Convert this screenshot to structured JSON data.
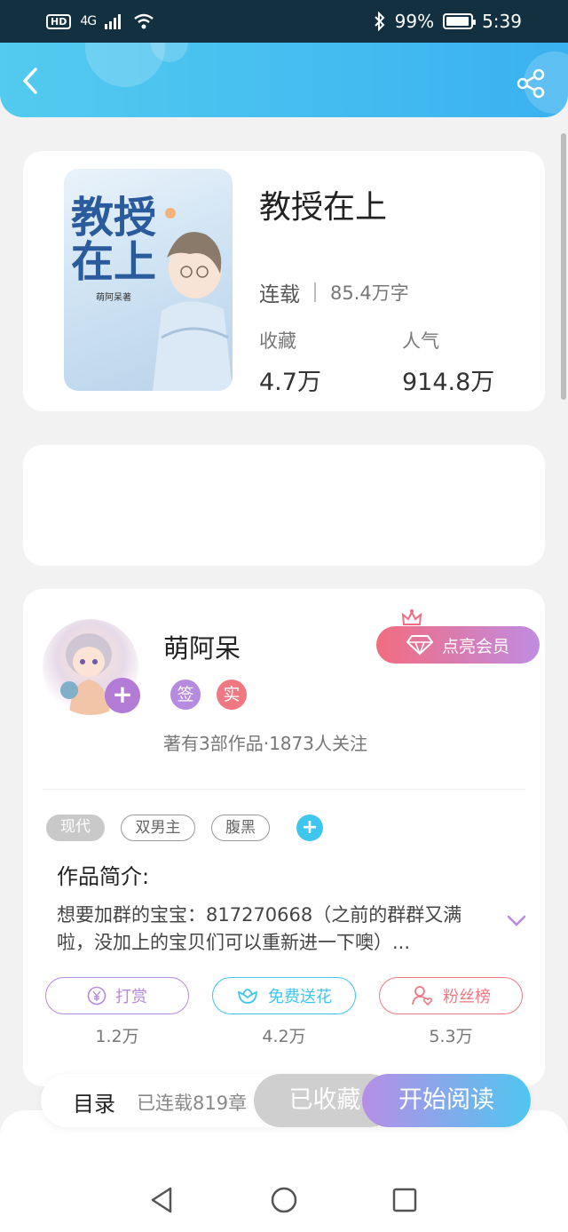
{
  "status_bar": {
    "hd_badge": "HD",
    "signal": "4G",
    "battery_percent": "99%",
    "time": "5:39"
  },
  "header": {
    "back_icon": "chevron-left-icon",
    "share_icon": "share-icon"
  },
  "book": {
    "cover_title": "教授在上",
    "cover_author": "萌阿呆著",
    "title": "教授在上",
    "status": "连载",
    "word_count": "85.4万字",
    "favorites_label": "收藏",
    "favorites_value": "4.7万",
    "popularity_label": "人气",
    "popularity_value": "914.8万"
  },
  "author": {
    "name": "萌阿呆",
    "badges": [
      "签",
      "实"
    ],
    "badge_colors": [
      "#b68ade",
      "#f07882"
    ],
    "meta": "著有3部作品·1873人关注",
    "vip_button": "点亮会员"
  },
  "tags": [
    "现代",
    "双男主",
    "腹黑"
  ],
  "intro": {
    "title": "作品简介:",
    "text": "想要加群的宝宝：817270668（之前的群群又满啦，没加上的宝贝们可以重新进一下噢）..."
  },
  "actions": [
    {
      "label": "打赏",
      "count": "1.2万",
      "icon": "yen-icon",
      "color": "#b68ade"
    },
    {
      "label": "免费送花",
      "count": "4.2万",
      "icon": "flower-icon",
      "color": "#3fc6ef"
    },
    {
      "label": "粉丝榜",
      "count": "5.3万",
      "icon": "user-heart-icon",
      "color": "#f07882"
    }
  ],
  "bottom_bar": {
    "toc_label": "目录",
    "toc_status": "已连载819章",
    "favorited_button": "已收藏",
    "read_button": "开始阅读"
  },
  "colors": {
    "header_gradient_start": "#53cbef",
    "header_gradient_end": "#3ab1f0",
    "read_gradient_start": "#b78ee6",
    "read_gradient_end": "#4fc6f0"
  }
}
